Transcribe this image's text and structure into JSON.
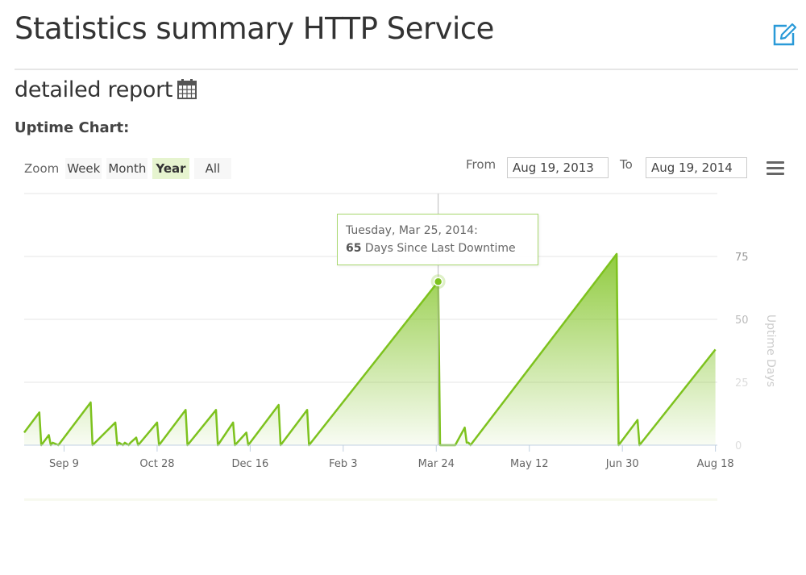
{
  "header": {
    "title": "Statistics summary HTTP Service",
    "edit_icon": "edit-icon",
    "subtitle": "detailed report",
    "calendar_icon": "calendar-icon",
    "section_label": "Uptime Chart:"
  },
  "toolbar": {
    "zoom_label": "Zoom",
    "zoom_options": [
      {
        "label": "Week",
        "active": false
      },
      {
        "label": "Month",
        "active": false
      },
      {
        "label": "Year",
        "active": true
      },
      {
        "label": "All",
        "active": false
      }
    ],
    "from_label": "From",
    "from_value": "Aug 19, 2013",
    "to_label": "To",
    "to_value": "Aug 19, 2014",
    "menu_icon": "hamburger-menu-icon"
  },
  "colors": {
    "accent": "#7dc21e",
    "edit_icon": "#2a9ad8",
    "active_zoom_bg": "#e6f4cf"
  },
  "tooltip": {
    "date": "Tuesday, Mar 25, 2014:",
    "value": "65",
    "suffix": " Days Since Last Downtime"
  },
  "chart_data": {
    "type": "area",
    "title": "",
    "xlabel": "",
    "ylabel": "Uptime Days",
    "x_unit": "days since Aug 19, 2013",
    "xlim": [
      0,
      365
    ],
    "ylim": [
      0,
      75
    ],
    "y_ticks": [
      0,
      25,
      50,
      75
    ],
    "x_ticks": [
      {
        "label": "Sep 9",
        "day": 21
      },
      {
        "label": "Oct 28",
        "day": 70
      },
      {
        "label": "Dec 16",
        "day": 119
      },
      {
        "label": "Feb 3",
        "day": 168
      },
      {
        "label": "Mar 24",
        "day": 217
      },
      {
        "label": "May 12",
        "day": 266
      },
      {
        "label": "Jun 30",
        "day": 315
      },
      {
        "label": "Aug 18",
        "day": 364
      }
    ],
    "grid": true,
    "legend": "none",
    "highlight": {
      "date": "Mar 25, 2014",
      "day": 218,
      "value": 65
    },
    "series": [
      {
        "name": "Days Since Last Downtime",
        "points": [
          [
            0,
            5
          ],
          [
            8,
            13
          ],
          [
            9,
            0
          ],
          [
            13,
            4
          ],
          [
            14,
            0
          ],
          [
            15,
            1
          ],
          [
            18,
            0
          ],
          [
            35,
            17
          ],
          [
            36,
            0
          ],
          [
            48,
            9
          ],
          [
            49,
            0
          ],
          [
            50,
            1
          ],
          [
            52,
            0
          ],
          [
            53,
            1
          ],
          [
            55,
            0
          ],
          [
            56,
            1
          ],
          [
            59,
            3
          ],
          [
            60,
            0
          ],
          [
            70,
            9
          ],
          [
            71,
            0
          ],
          [
            85,
            14
          ],
          [
            86,
            0
          ],
          [
            101,
            14
          ],
          [
            102,
            0
          ],
          [
            110,
            9
          ],
          [
            111,
            0
          ],
          [
            117,
            5
          ],
          [
            118,
            0
          ],
          [
            134,
            16
          ],
          [
            135,
            0
          ],
          [
            149,
            14
          ],
          [
            150,
            0
          ],
          [
            218,
            65
          ],
          [
            219,
            0
          ],
          [
            227,
            0
          ],
          [
            232,
            7
          ],
          [
            233,
            1
          ],
          [
            234,
            1
          ],
          [
            235,
            0
          ],
          [
            312,
            76
          ],
          [
            313,
            0
          ],
          [
            323,
            10
          ],
          [
            324,
            0
          ],
          [
            364,
            38
          ]
        ]
      }
    ]
  }
}
